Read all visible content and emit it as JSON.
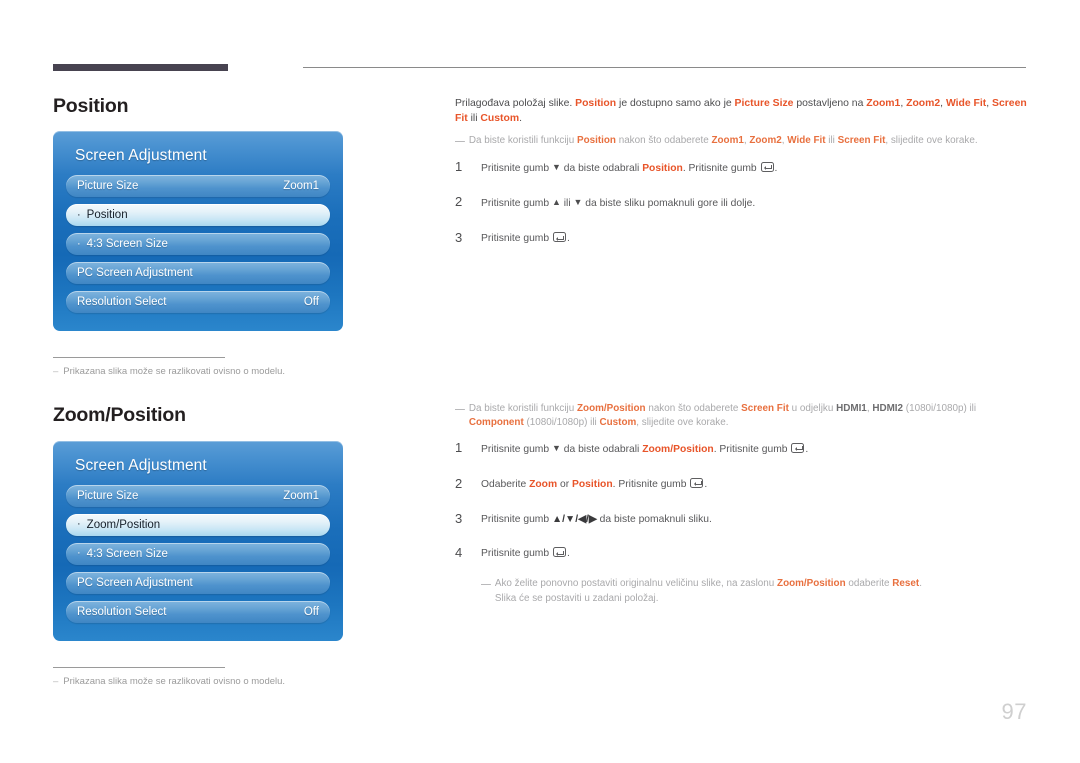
{
  "page": {
    "number": "97"
  },
  "sections": [
    {
      "heading": "Position",
      "panel": {
        "title": "Screen Adjustment",
        "rows": [
          {
            "bullet": "",
            "label": "Picture Size",
            "value": "Zoom1",
            "selected": false
          },
          {
            "bullet": "·",
            "label": "Position",
            "value": "",
            "selected": true
          },
          {
            "bullet": "·",
            "label": "4:3 Screen Size",
            "value": "",
            "selected": false
          },
          {
            "bullet": "",
            "label": "PC Screen Adjustment",
            "value": "",
            "selected": false
          },
          {
            "bullet": "",
            "label": "Resolution Select",
            "value": "Off",
            "selected": false
          }
        ]
      },
      "footnote": {
        "dash": "–",
        "text": "Prikazana slika može se razlikovati ovisno o modelu."
      }
    },
    {
      "heading": "Zoom/Position",
      "panel": {
        "title": "Screen Adjustment",
        "rows": [
          {
            "bullet": "",
            "label": "Picture Size",
            "value": "Zoom1",
            "selected": false
          },
          {
            "bullet": "·",
            "label": "Zoom/Position",
            "value": "",
            "selected": true
          },
          {
            "bullet": "·",
            "label": "4:3 Screen Size",
            "value": "",
            "selected": false
          },
          {
            "bullet": "",
            "label": "PC Screen Adjustment",
            "value": "",
            "selected": false
          },
          {
            "bullet": "",
            "label": "Resolution Select",
            "value": "Off",
            "selected": false
          }
        ]
      },
      "footnote": {
        "dash": "–",
        "text": "Prikazana slika može se razlikovati ovisno o modelu."
      }
    }
  ],
  "position_content": {
    "intro": {
      "t1": "Prilagođava položaj slike. ",
      "k1": "Position",
      "t2": " je dostupno samo ako je ",
      "k2": "Picture Size",
      "t3": " postavljeno na ",
      "k3": "Zoom1",
      "t4": ", ",
      "k4": "Zoom2",
      "t5": ", ",
      "k5": "Wide Fit",
      "t6": ", ",
      "k6": "Screen Fit",
      "t7": " ili ",
      "k7": "Custom",
      "t8": "."
    },
    "note": {
      "dash": "—",
      "t1": "Da biste koristili funkciju ",
      "k1": "Position",
      "t2": " nakon što odaberete ",
      "k2": "Zoom1",
      "t3": ", ",
      "k3": "Zoom2",
      "t4": ", ",
      "k4": "Wide Fit",
      "t5": " ili ",
      "k5": "Screen Fit",
      "t6": ", slijedite ove korake."
    },
    "steps": [
      {
        "num": "1",
        "t1": "Pritisnite gumb ",
        "arrow1": "▼",
        "t2": " da biste odabrali ",
        "k1": "Position",
        "t3": ". Pritisnite gumb ",
        "t4": "."
      },
      {
        "num": "2",
        "t1": "Pritisnite gumb ",
        "arrow1": "▲",
        "t2": " ili ",
        "arrow2": "▼",
        "t3": " da biste sliku pomaknuli gore ili dolje."
      },
      {
        "num": "3",
        "t1": "Pritisnite gumb ",
        "t2": "."
      }
    ]
  },
  "zoom_position_content": {
    "note": {
      "dash": "—",
      "t1": "Da biste koristili funkciju ",
      "k1": "Zoom/Position",
      "t2": " nakon što odaberete ",
      "k2": "Screen Fit",
      "t3": " u odjeljku ",
      "k3": "HDMI1",
      "t4": ", ",
      "k4": "HDMI2",
      "t5": " (1080i/1080p) ili ",
      "k5": "Component",
      "t6": " (1080i/1080p) ili ",
      "k6": "Custom",
      "t7": ", slijedite ove korake."
    },
    "steps": [
      {
        "num": "1",
        "t1": "Pritisnite gumb ",
        "arrow1": "▼",
        "t2": " da biste odabrali ",
        "k1": "Zoom/Position",
        "t3": ". Pritisnite gumb ",
        "t4": "."
      },
      {
        "num": "2",
        "t1": "Odaberite ",
        "k1": "Zoom",
        "t2": " or ",
        "k2": "Position",
        "t3": ". Pritisnite gumb ",
        "t4": "."
      },
      {
        "num": "3",
        "t1": "Pritisnite gumb ",
        "arrows": "▲/▼/◀/▶",
        "t2": " da biste pomaknuli sliku."
      },
      {
        "num": "4",
        "t1": "Pritisnite gumb ",
        "t2": "."
      }
    ],
    "reset_note": {
      "dash": "—",
      "t1": "Ako želite ponovno postaviti originalnu veličinu slike, na zaslonu ",
      "k1": "Zoom/Position",
      "t2": " odaberite ",
      "k2": "Reset",
      "t3": ".",
      "line2": "Slika će se postaviti u zadani položaj."
    }
  },
  "colors": {
    "accent": "#e8552a",
    "panel_blue": "#1b6fbb",
    "rule_dark": "#474350"
  }
}
